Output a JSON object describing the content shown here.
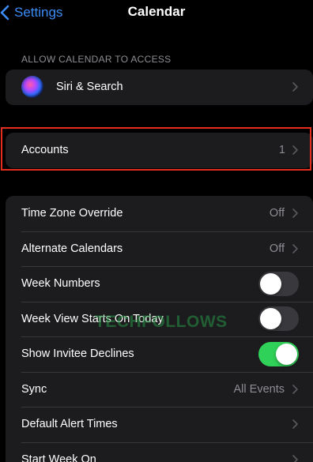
{
  "nav": {
    "back_label": "Settings",
    "title": "Calendar"
  },
  "access_section": {
    "header": "ALLOW CALENDAR TO ACCESS",
    "items": [
      {
        "label": "Siri & Search",
        "icon": "siri-icon"
      }
    ]
  },
  "accounts": {
    "label": "Accounts",
    "value": "1"
  },
  "settings": {
    "items": [
      {
        "label": "Time Zone Override",
        "value": "Off",
        "type": "disclosure"
      },
      {
        "label": "Alternate Calendars",
        "value": "Off",
        "type": "disclosure"
      },
      {
        "label": "Week Numbers",
        "type": "toggle",
        "on": false
      },
      {
        "label": "Week View Starts On Today",
        "type": "toggle",
        "on": false
      },
      {
        "label": "Show Invitee Declines",
        "type": "toggle",
        "on": true
      },
      {
        "label": "Sync",
        "value": "All Events",
        "type": "disclosure"
      },
      {
        "label": "Default Alert Times",
        "type": "disclosure"
      },
      {
        "label": "Start Week On",
        "type": "disclosure"
      }
    ]
  },
  "watermark": "TECHFOLLOWS",
  "colors": {
    "background": "#000000",
    "cell": "#1c1c1e",
    "accent_blue": "#3b8cf7",
    "toggle_on": "#30d158",
    "toggle_off": "#39393d",
    "highlight_border": "#e22d1f",
    "secondary_text": "#8d8d93"
  }
}
